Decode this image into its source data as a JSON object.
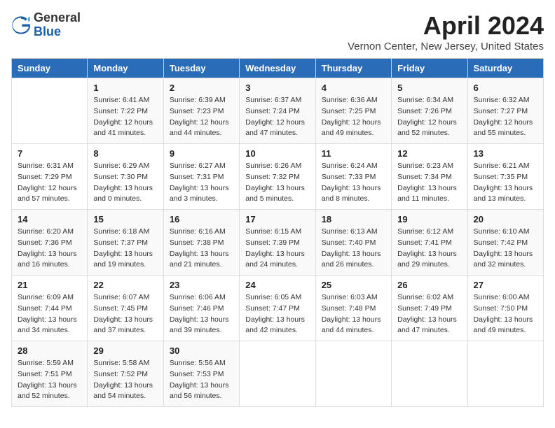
{
  "header": {
    "logo_general": "General",
    "logo_blue": "Blue",
    "month": "April 2024",
    "location": "Vernon Center, New Jersey, United States"
  },
  "days_of_week": [
    "Sunday",
    "Monday",
    "Tuesday",
    "Wednesday",
    "Thursday",
    "Friday",
    "Saturday"
  ],
  "weeks": [
    [
      {
        "day": "",
        "info": ""
      },
      {
        "day": "1",
        "info": "Sunrise: 6:41 AM\nSunset: 7:22 PM\nDaylight: 12 hours\nand 41 minutes."
      },
      {
        "day": "2",
        "info": "Sunrise: 6:39 AM\nSunset: 7:23 PM\nDaylight: 12 hours\nand 44 minutes."
      },
      {
        "day": "3",
        "info": "Sunrise: 6:37 AM\nSunset: 7:24 PM\nDaylight: 12 hours\nand 47 minutes."
      },
      {
        "day": "4",
        "info": "Sunrise: 6:36 AM\nSunset: 7:25 PM\nDaylight: 12 hours\nand 49 minutes."
      },
      {
        "day": "5",
        "info": "Sunrise: 6:34 AM\nSunset: 7:26 PM\nDaylight: 12 hours\nand 52 minutes."
      },
      {
        "day": "6",
        "info": "Sunrise: 6:32 AM\nSunset: 7:27 PM\nDaylight: 12 hours\nand 55 minutes."
      }
    ],
    [
      {
        "day": "7",
        "info": "Sunrise: 6:31 AM\nSunset: 7:29 PM\nDaylight: 12 hours\nand 57 minutes."
      },
      {
        "day": "8",
        "info": "Sunrise: 6:29 AM\nSunset: 7:30 PM\nDaylight: 13 hours\nand 0 minutes."
      },
      {
        "day": "9",
        "info": "Sunrise: 6:27 AM\nSunset: 7:31 PM\nDaylight: 13 hours\nand 3 minutes."
      },
      {
        "day": "10",
        "info": "Sunrise: 6:26 AM\nSunset: 7:32 PM\nDaylight: 13 hours\nand 5 minutes."
      },
      {
        "day": "11",
        "info": "Sunrise: 6:24 AM\nSunset: 7:33 PM\nDaylight: 13 hours\nand 8 minutes."
      },
      {
        "day": "12",
        "info": "Sunrise: 6:23 AM\nSunset: 7:34 PM\nDaylight: 13 hours\nand 11 minutes."
      },
      {
        "day": "13",
        "info": "Sunrise: 6:21 AM\nSunset: 7:35 PM\nDaylight: 13 hours\nand 13 minutes."
      }
    ],
    [
      {
        "day": "14",
        "info": "Sunrise: 6:20 AM\nSunset: 7:36 PM\nDaylight: 13 hours\nand 16 minutes."
      },
      {
        "day": "15",
        "info": "Sunrise: 6:18 AM\nSunset: 7:37 PM\nDaylight: 13 hours\nand 19 minutes."
      },
      {
        "day": "16",
        "info": "Sunrise: 6:16 AM\nSunset: 7:38 PM\nDaylight: 13 hours\nand 21 minutes."
      },
      {
        "day": "17",
        "info": "Sunrise: 6:15 AM\nSunset: 7:39 PM\nDaylight: 13 hours\nand 24 minutes."
      },
      {
        "day": "18",
        "info": "Sunrise: 6:13 AM\nSunset: 7:40 PM\nDaylight: 13 hours\nand 26 minutes."
      },
      {
        "day": "19",
        "info": "Sunrise: 6:12 AM\nSunset: 7:41 PM\nDaylight: 13 hours\nand 29 minutes."
      },
      {
        "day": "20",
        "info": "Sunrise: 6:10 AM\nSunset: 7:42 PM\nDaylight: 13 hours\nand 32 minutes."
      }
    ],
    [
      {
        "day": "21",
        "info": "Sunrise: 6:09 AM\nSunset: 7:44 PM\nDaylight: 13 hours\nand 34 minutes."
      },
      {
        "day": "22",
        "info": "Sunrise: 6:07 AM\nSunset: 7:45 PM\nDaylight: 13 hours\nand 37 minutes."
      },
      {
        "day": "23",
        "info": "Sunrise: 6:06 AM\nSunset: 7:46 PM\nDaylight: 13 hours\nand 39 minutes."
      },
      {
        "day": "24",
        "info": "Sunrise: 6:05 AM\nSunset: 7:47 PM\nDaylight: 13 hours\nand 42 minutes."
      },
      {
        "day": "25",
        "info": "Sunrise: 6:03 AM\nSunset: 7:48 PM\nDaylight: 13 hours\nand 44 minutes."
      },
      {
        "day": "26",
        "info": "Sunrise: 6:02 AM\nSunset: 7:49 PM\nDaylight: 13 hours\nand 47 minutes."
      },
      {
        "day": "27",
        "info": "Sunrise: 6:00 AM\nSunset: 7:50 PM\nDaylight: 13 hours\nand 49 minutes."
      }
    ],
    [
      {
        "day": "28",
        "info": "Sunrise: 5:59 AM\nSunset: 7:51 PM\nDaylight: 13 hours\nand 52 minutes."
      },
      {
        "day": "29",
        "info": "Sunrise: 5:58 AM\nSunset: 7:52 PM\nDaylight: 13 hours\nand 54 minutes."
      },
      {
        "day": "30",
        "info": "Sunrise: 5:56 AM\nSunset: 7:53 PM\nDaylight: 13 hours\nand 56 minutes."
      },
      {
        "day": "",
        "info": ""
      },
      {
        "day": "",
        "info": ""
      },
      {
        "day": "",
        "info": ""
      },
      {
        "day": "",
        "info": ""
      }
    ]
  ]
}
